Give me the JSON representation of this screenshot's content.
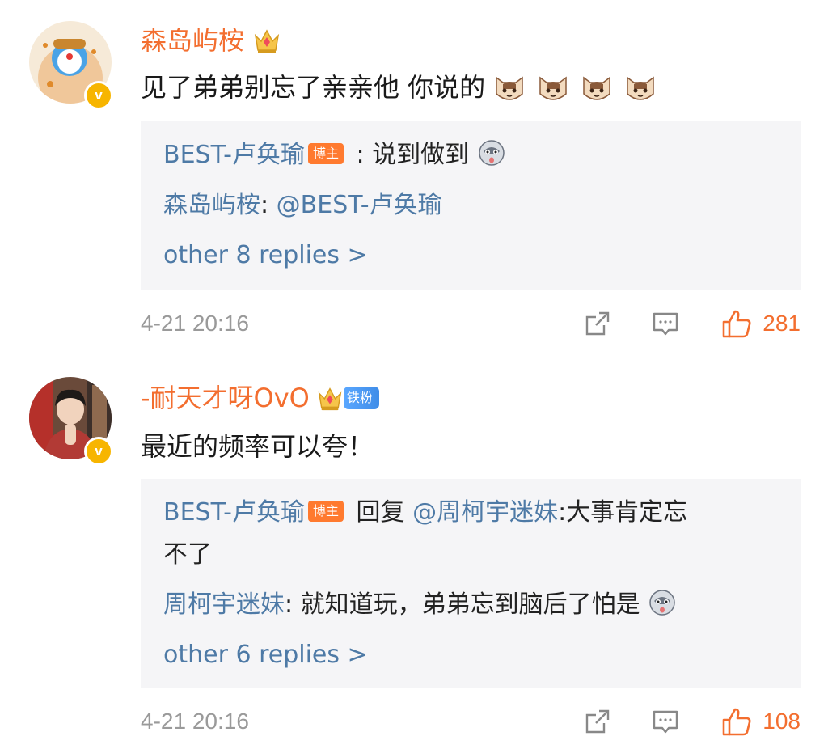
{
  "comments": [
    {
      "username": "森岛屿桉",
      "text": "见了弟弟别忘了亲亲他 你说的",
      "emoji_count_icon": "cat-face-emoji",
      "replies": [
        {
          "name": "BEST-卢奂瑜",
          "badge": "博主",
          "sep": " : ",
          "text": "说到做到"
        },
        {
          "name": "森岛屿桉",
          "sep": ": ",
          "mention": "@BEST-卢奂瑜",
          "text": ""
        }
      ],
      "more_replies": "other 8 replies >",
      "time": "4-21 20:16",
      "likes": "281"
    },
    {
      "username": "-耐天才呀OvO",
      "fan_badge": "铁粉",
      "text": "最近的频率可以夸！",
      "replies": [
        {
          "name": "BEST-卢奂瑜",
          "badge": "博主",
          "pre": " 回复 ",
          "mention": "@周柯宇迷妹",
          "text": ":大事肯定忘",
          "cont": "不了"
        },
        {
          "name": "周柯宇迷妹",
          "sep": ": ",
          "text": "就知道玩，弟弟忘到脑后了怕是"
        }
      ],
      "more_replies": "other 6 replies >",
      "time": "4-21 20:16",
      "likes": "108"
    }
  ],
  "colors": {
    "username": "#f36e2f",
    "link": "#4e7aa6",
    "reply_bg": "#f5f5f7",
    "verified": "#f7b500",
    "like": "#f36e2f"
  },
  "icons": [
    "verified-badge-icon",
    "crown-icon",
    "share-icon",
    "comment-icon",
    "like-icon",
    "husky-emoji",
    "cat-face-emoji"
  ]
}
